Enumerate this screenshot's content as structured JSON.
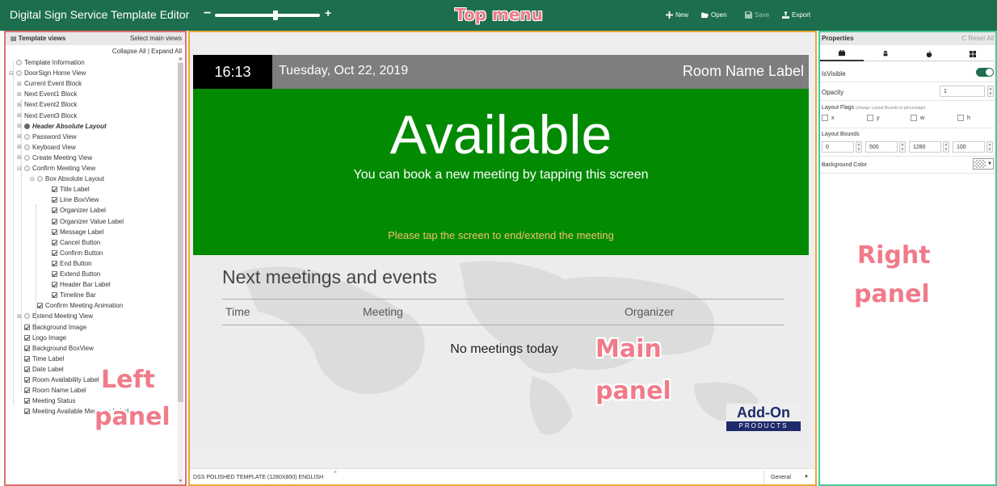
{
  "app": {
    "title": "Digital Sign Service Template Editor",
    "annotation_top": "Top menu",
    "toolbar": {
      "new_label": "New",
      "open_label": "Open",
      "save_label": "Save",
      "export_label": "Export"
    },
    "zoom": {
      "minus": "−",
      "plus": "+",
      "value_fraction": 0.58
    }
  },
  "left_panel": {
    "title": "Template views",
    "select_main": "Select main views",
    "collapse_expand": "Collapse All | Expand All",
    "annotation": [
      "Left",
      "panel"
    ],
    "items": [
      {
        "label": "Template Information",
        "indent": 0,
        "kind": "radio",
        "exp": ""
      },
      {
        "label": "DoorSign Home View",
        "indent": 0,
        "kind": "radio",
        "exp": "⊟"
      },
      {
        "label": "Current Event Block",
        "indent": 1,
        "kind": "none",
        "exp": "⊞"
      },
      {
        "label": "Next Event1 Block",
        "indent": 1,
        "kind": "none",
        "exp": "⊞"
      },
      {
        "label": "Next Event2 Block",
        "indent": 1,
        "kind": "none",
        "exp": "⊞"
      },
      {
        "label": "Next Event3 Block",
        "indent": 1,
        "kind": "none",
        "exp": "⊞"
      },
      {
        "label": "Header Absolute Layout",
        "indent": 1,
        "kind": "radio-on",
        "exp": "⊞",
        "bold": true
      },
      {
        "label": "Password View",
        "indent": 1,
        "kind": "radio",
        "exp": "⊞"
      },
      {
        "label": "Keyboard View",
        "indent": 1,
        "kind": "radio",
        "exp": "⊞"
      },
      {
        "label": "Create Meeting View",
        "indent": 1,
        "kind": "radio",
        "exp": "⊞"
      },
      {
        "label": "Confirm Meeting View",
        "indent": 1,
        "kind": "radio",
        "exp": "⊟"
      },
      {
        "label": "Box Absolute Layout",
        "indent": 2,
        "kind": "radio",
        "exp": "⊟"
      },
      {
        "label": "Title Label",
        "indent": 3,
        "kind": "check",
        "exp": ""
      },
      {
        "label": "Line BoxView",
        "indent": 3,
        "kind": "check",
        "exp": ""
      },
      {
        "label": "Organizer Label",
        "indent": 3,
        "kind": "check",
        "exp": ""
      },
      {
        "label": "Organizer Value Label",
        "indent": 3,
        "kind": "check",
        "exp": ""
      },
      {
        "label": "Message Label",
        "indent": 3,
        "kind": "check",
        "exp": ""
      },
      {
        "label": "Cancel Button",
        "indent": 3,
        "kind": "check",
        "exp": ""
      },
      {
        "label": "Confirm Button",
        "indent": 3,
        "kind": "check",
        "exp": ""
      },
      {
        "label": "End Button",
        "indent": 3,
        "kind": "check",
        "exp": ""
      },
      {
        "label": "Extend Button",
        "indent": 3,
        "kind": "check",
        "exp": ""
      },
      {
        "label": "Header Bar Label",
        "indent": 3,
        "kind": "check",
        "exp": ""
      },
      {
        "label": "Timeline Bar",
        "indent": 3,
        "kind": "check",
        "exp": ""
      },
      {
        "label": "Confirm Meeting Animation",
        "indent": 2,
        "kind": "check",
        "exp": ""
      },
      {
        "label": "Extend Meeting View",
        "indent": 1,
        "kind": "radio",
        "exp": "⊞"
      },
      {
        "label": "Background Image",
        "indent": 1,
        "kind": "check",
        "exp": ""
      },
      {
        "label": "Logo Image",
        "indent": 1,
        "kind": "check",
        "exp": ""
      },
      {
        "label": "Background BoxView",
        "indent": 1,
        "kind": "check",
        "exp": ""
      },
      {
        "label": "Time Label",
        "indent": 1,
        "kind": "check",
        "exp": ""
      },
      {
        "label": "Date Label",
        "indent": 1,
        "kind": "check",
        "exp": ""
      },
      {
        "label": "Room Availability Label",
        "indent": 1,
        "kind": "check",
        "exp": ""
      },
      {
        "label": "Room Name Label",
        "indent": 1,
        "kind": "check",
        "exp": ""
      },
      {
        "label": "Meeting Status",
        "indent": 1,
        "kind": "check",
        "exp": ""
      },
      {
        "label": "Meeting Available Message Label",
        "indent": 1,
        "kind": "check",
        "exp": ""
      }
    ]
  },
  "main_panel": {
    "annotation": [
      "Main",
      "panel"
    ],
    "sign": {
      "time": "16:13",
      "date": "Tuesday, Oct 22, 2019",
      "room": "Room Name Label",
      "status": "Available",
      "book_message": "You can book a new meeting by tapping this screen",
      "tap_message": "Please tap the screen to end/extend the meeting",
      "next_title": "Next meetings and events",
      "col_time": "Time",
      "col_meeting": "Meeting",
      "col_organizer": "Organizer",
      "no_meetings": "No meetings today",
      "logo_top": "Add-On",
      "logo_bottom": "PRODUCTS"
    },
    "footer": {
      "tab_label": "DSS POLISHED TEMPLATE (1280X800) ENGLISH",
      "tab_close": "×",
      "select_value": "General"
    }
  },
  "right_panel": {
    "title": "Properties",
    "reset": "C Reset All",
    "annotation": [
      "Right",
      "panel"
    ],
    "tabs": [
      "general-icon",
      "android-icon",
      "apple-icon",
      "windows-icon"
    ],
    "is_visible_label": "IsVisible",
    "is_visible": true,
    "opacity_label": "Opacity",
    "opacity_value": "1",
    "layout_flags_label": "Layout Flags",
    "layout_flags_hint": "(change Layout Bounds to percentage)",
    "flags": [
      "x",
      "y",
      "w",
      "h"
    ],
    "layout_bounds_label": "Layout Bounds",
    "bounds": [
      "0",
      "500",
      "1280",
      "100"
    ],
    "bg_color_label": "Background Color"
  },
  "colors": {
    "topbar": "#1c6e4d",
    "available_green": "#038a03",
    "annotation": "#f07b8a",
    "left_border": "#e07070",
    "main_border": "#e8a83a",
    "right_border": "#4cc89a"
  }
}
